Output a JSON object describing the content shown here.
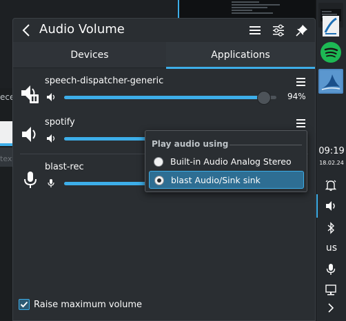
{
  "background": {
    "left_text": "ece",
    "left_text2": "text"
  },
  "panel": {
    "title": "Audio Volume",
    "tabs": [
      {
        "label": "Devices",
        "active": false
      },
      {
        "label": "Applications",
        "active": true
      }
    ],
    "streams": [
      {
        "name": "speech-dispatcher-generic",
        "volume_percent": 94,
        "volume_label": "94%",
        "paused": true
      },
      {
        "name": "spotify",
        "volume_percent": 40,
        "paused": false
      },
      {
        "name": "blast-rec",
        "volume_percent": 40,
        "paused": false
      }
    ],
    "footer": {
      "label": "Raise maximum volume",
      "checked": true
    }
  },
  "popup": {
    "title": "Play audio using",
    "options": [
      {
        "label": "Built-in Audio Analog Stereo",
        "selected": false
      },
      {
        "label": "blast Audio/Sink sink",
        "selected": true
      }
    ]
  },
  "tray": {
    "time": "09:19",
    "date": "18.02.24",
    "keyboard_layout": "us"
  },
  "colors": {
    "accent": "#3daee9",
    "panel_bg": "#2a2e32",
    "spotify_green": "#1db954"
  }
}
